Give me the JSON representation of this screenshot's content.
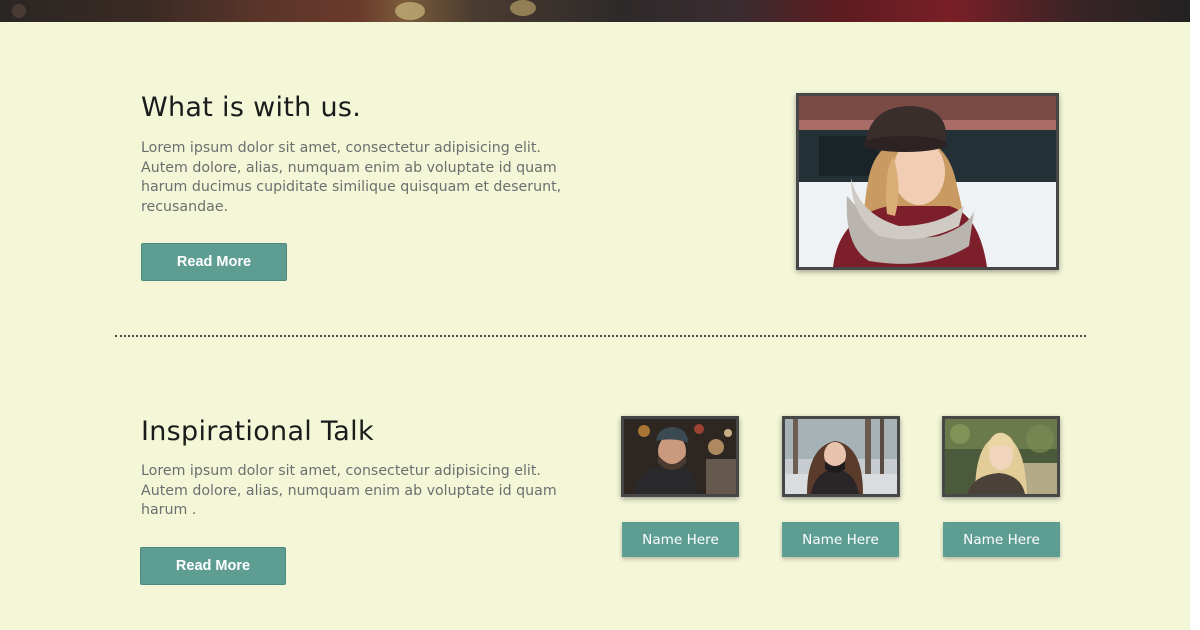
{
  "section_about": {
    "title": "What is with us.",
    "paragraph": "Lorem ipsum dolor sit amet, consectetur adipisicing elit. Autem dolore, alias, numquam enim ab voluptate id quam harum ducimus cupiditate similique quisquam et deserunt, recusandae.",
    "read_more_label": "Read More"
  },
  "section_talk": {
    "title": "Inspirational Talk",
    "paragraph": "Lorem ipsum dolor sit amet, consectetur adipisicing elit. Autem dolore, alias, numquam enim ab voluptate id quam harum .",
    "read_more_label": "Read More",
    "speakers": [
      {
        "name_label": "Name Here"
      },
      {
        "name_label": "Name Here"
      },
      {
        "name_label": "Name Here"
      }
    ]
  },
  "colors": {
    "page_background": "#f4f6d8",
    "button": "#5e9e92",
    "heading_text": "#1b1b1b",
    "body_text": "#6e6e6e",
    "photo_border": "#474747"
  }
}
